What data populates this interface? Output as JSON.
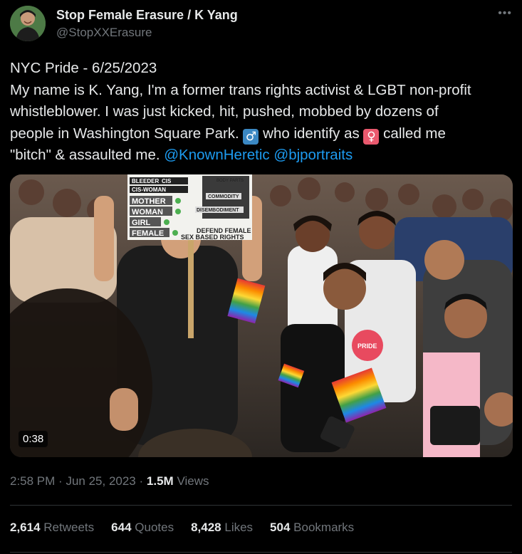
{
  "author": {
    "name": "Stop Female Erasure / K Yang",
    "handle": "@StopXXErasure"
  },
  "more_glyph": "•••",
  "tweet": {
    "line1": "NYC Pride - 6/25/2023",
    "line2": "My name is K. Yang, I'm a former trans rights activist & LGBT non-profit",
    "line3": "whistleblower. I was just kicked, hit, pushed, mobbed by dozens of",
    "line4a": "people in Washington Square Park.",
    "male_symbol": "♂",
    "line4b": "who identify as",
    "female_symbol": "♀",
    "line4c": "called me",
    "line5a": "\"bitch\" & assaulted me.",
    "mention1": "@KnownHeretic",
    "mention2": "@bjportraits"
  },
  "media": {
    "duration": "0:38",
    "sign": {
      "left_top": "BLEEDER",
      "left_top2": "CIS",
      "left_row2": "CIS-WOMAN",
      "mother": "MOTHER",
      "woman": "WOMAN",
      "girl": "GIRL",
      "female": "FEMALE",
      "body_parts": "BODY PARTS",
      "commodity": "COMMODITY",
      "disembodiment": "DISEMBODIMENT",
      "defend": "DEFEND FEMALE",
      "sex_rights": "SEX BASED RIGHTS"
    },
    "hand_sign": "PRIDE"
  },
  "meta": {
    "time": "2:58 PM",
    "dot": "·",
    "date": "Jun 25, 2023",
    "views_count": "1.5M",
    "views_label": "Views"
  },
  "stats": {
    "retweets_count": "2,614",
    "retweets_label": "Retweets",
    "quotes_count": "644",
    "quotes_label": "Quotes",
    "likes_count": "8,428",
    "likes_label": "Likes",
    "bookmarks_count": "504",
    "bookmarks_label": "Bookmarks"
  }
}
